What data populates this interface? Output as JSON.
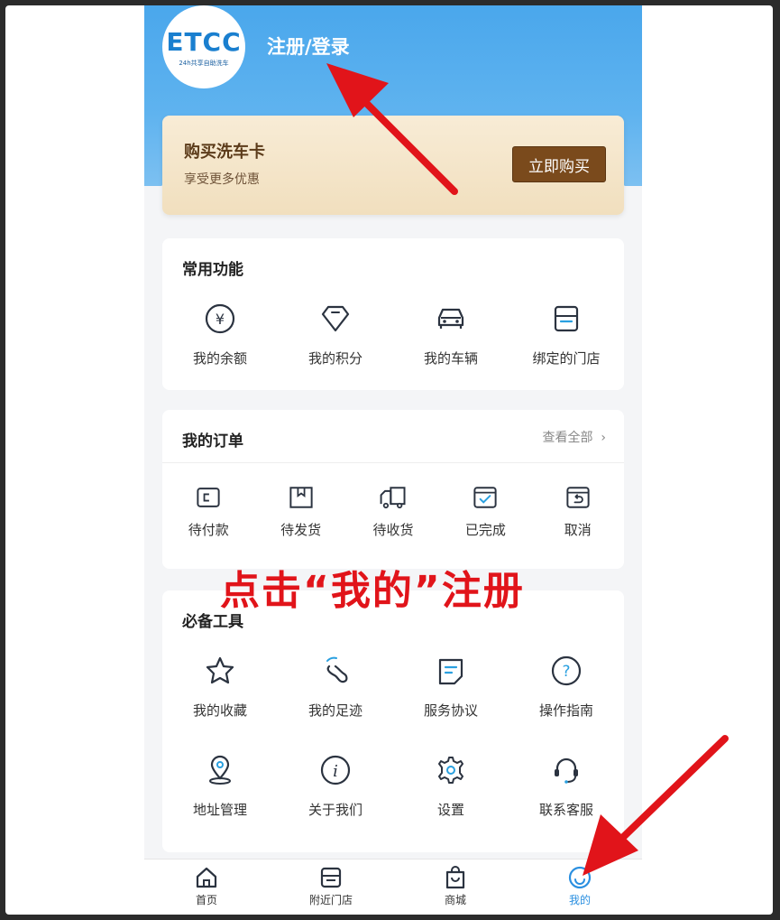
{
  "header": {
    "logo_text": "ETCC",
    "logo_subtext": "24h共享自助洗车",
    "login_label": "注册/登录"
  },
  "promo": {
    "title": "购买洗车卡",
    "subtitle": "享受更多优惠",
    "button_label": "立即购买"
  },
  "common": {
    "title": "常用功能",
    "items": [
      {
        "label": "我的余额",
        "icon": "yen-coin-icon"
      },
      {
        "label": "我的积分",
        "icon": "diamond-icon"
      },
      {
        "label": "我的车辆",
        "icon": "car-icon"
      },
      {
        "label": "绑定的门店",
        "icon": "store-icon"
      }
    ]
  },
  "orders": {
    "title": "我的订单",
    "see_all": "查看全部",
    "items": [
      {
        "label": "待付款",
        "icon": "wallet-icon"
      },
      {
        "label": "待发货",
        "icon": "package-icon"
      },
      {
        "label": "待收货",
        "icon": "truck-icon"
      },
      {
        "label": "已完成",
        "icon": "calendar-check-icon"
      },
      {
        "label": "取消",
        "icon": "return-icon"
      }
    ]
  },
  "tools": {
    "title": "必备工具",
    "items": [
      {
        "label": "我的收藏",
        "icon": "star-icon"
      },
      {
        "label": "我的足迹",
        "icon": "footprint-icon"
      },
      {
        "label": "服务协议",
        "icon": "document-icon"
      },
      {
        "label": "操作指南",
        "icon": "question-icon"
      },
      {
        "label": "地址管理",
        "icon": "location-pin-icon"
      },
      {
        "label": "关于我们",
        "icon": "info-icon"
      },
      {
        "label": "设置",
        "icon": "gear-icon"
      },
      {
        "label": "联系客服",
        "icon": "headset-icon"
      }
    ]
  },
  "tabbar": {
    "items": [
      {
        "label": "首页",
        "icon": "home-icon"
      },
      {
        "label": "附近门店",
        "icon": "store-icon"
      },
      {
        "label": "商城",
        "icon": "shopping-bag-icon"
      },
      {
        "label": "我的",
        "icon": "smile-icon",
        "active": true
      }
    ]
  },
  "annotation": {
    "text": "点击“我的”注册",
    "color": "#e1141a"
  },
  "colors": {
    "accent": "#2a8fe0",
    "header_blue": "#4aa7ec",
    "promo_button": "#7a4a1c"
  }
}
